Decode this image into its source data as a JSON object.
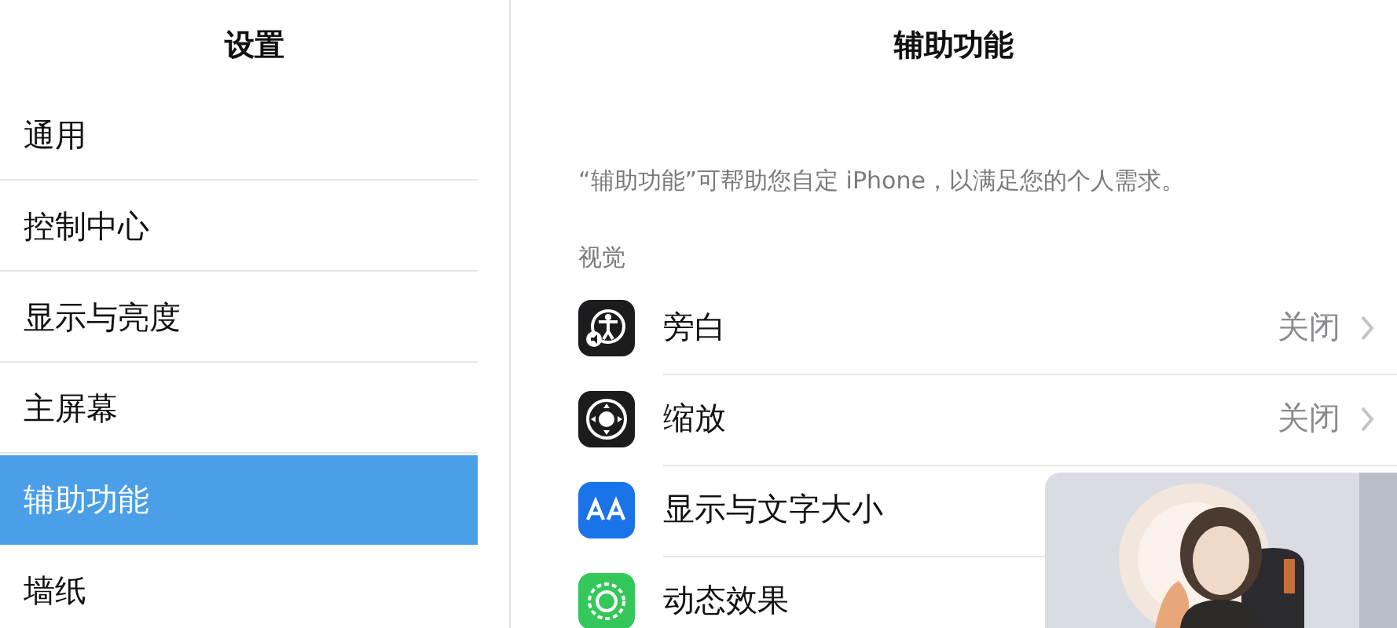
{
  "sidebar": {
    "title": "设置",
    "items": [
      {
        "label": "通用",
        "selected": false
      },
      {
        "label": "控制中心",
        "selected": false
      },
      {
        "label": "显示与亮度",
        "selected": false
      },
      {
        "label": "主屏幕",
        "selected": false
      },
      {
        "label": "辅助功能",
        "selected": true
      },
      {
        "label": "墙纸",
        "selected": false
      }
    ]
  },
  "detail": {
    "title": "辅助功能",
    "description": "“辅助功能”可帮助您自定 iPhone，以满足您的个人需求。",
    "section": "视觉",
    "rows": [
      {
        "kind": "voiceover",
        "label": "旁白",
        "value": "关闭"
      },
      {
        "kind": "zoom",
        "label": "缩放",
        "value": "关闭"
      },
      {
        "kind": "text-size",
        "label": "显示与文字大小"
      },
      {
        "kind": "motion",
        "label": "动态效果"
      }
    ]
  }
}
